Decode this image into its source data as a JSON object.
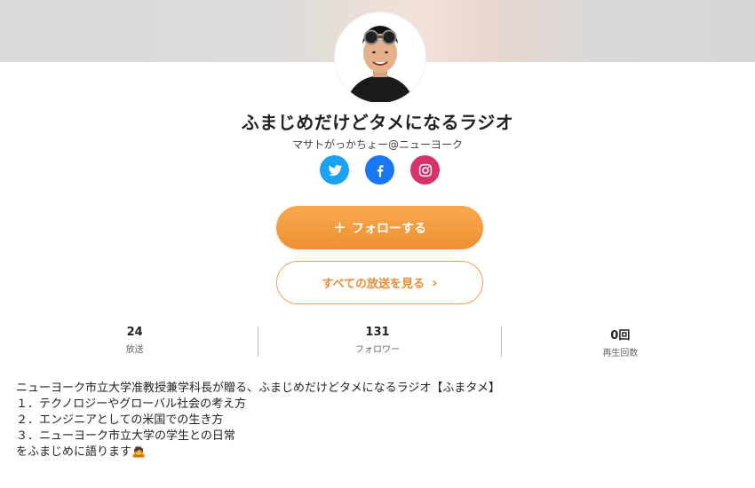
{
  "channel": {
    "title": "ふまじめだけどタメになるラジオ",
    "author": "マサトがっかちょー@ニューヨーク"
  },
  "social": {
    "twitter_icon": "twitter-icon",
    "facebook_icon": "facebook-icon",
    "instagram_icon": "instagram-icon",
    "colors": {
      "twitter": "#1da1f2",
      "facebook": "#1877f2",
      "instagram": "#d6336c"
    }
  },
  "actions": {
    "follow_label": "フォローする",
    "follow_icon": "+",
    "all_broadcasts_label": "すべての放送を見る",
    "all_broadcasts_icon": "›"
  },
  "stats": [
    {
      "value": "24",
      "label": "放送"
    },
    {
      "value": "131",
      "label": "フォロワー"
    },
    {
      "value": "0回",
      "label": "再生回数"
    }
  ],
  "description": {
    "lines": [
      "ニューヨーク市立大学准教授兼学科長が贈る、ふまじめだけどタメになるラジオ【ふまタメ】",
      "１．テクノロジーやグローバル社会の考え方",
      "２．エンジニアとしての米国での生き方",
      "３．ニューヨーク市立大学の学生との日常",
      "をふまじめに語ります🙇"
    ]
  },
  "theme": {
    "accent": "#f08f34"
  }
}
